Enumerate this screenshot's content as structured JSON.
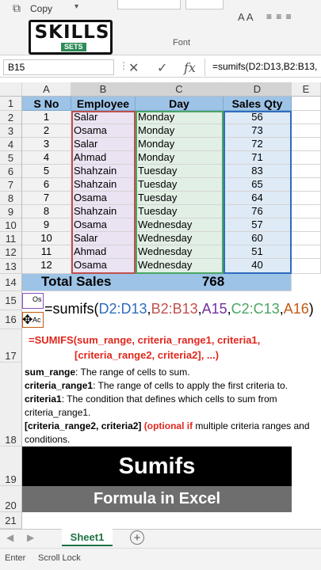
{
  "ribbon": {
    "copy_label": "Copy",
    "font_group_label": "Font"
  },
  "logo": {
    "top_text": "SKILLS",
    "bottom_text": "SETS"
  },
  "formula_bar": {
    "name_box": "B15",
    "formula": "=sumifs(D2:D13,B2:B13,"
  },
  "columns": [
    "A",
    "B",
    "C",
    "D",
    "E"
  ],
  "rows": [
    "1",
    "2",
    "3",
    "4",
    "5",
    "6",
    "7",
    "8",
    "9",
    "10",
    "11",
    "12",
    "13",
    "14",
    "15",
    "16",
    "17",
    "18",
    "19",
    "20",
    "21"
  ],
  "table": {
    "headers": [
      "S No",
      "Employee",
      "Day",
      "Sales Qty"
    ],
    "data": [
      [
        "1",
        "Salar",
        "Monday",
        "56"
      ],
      [
        "2",
        "Osama",
        "Monday",
        "73"
      ],
      [
        "3",
        "Salar",
        "Monday",
        "72"
      ],
      [
        "4",
        "Ahmad",
        "Monday",
        "71"
      ],
      [
        "5",
        "Shahzain",
        "Tuesday",
        "83"
      ],
      [
        "6",
        "Shahzain",
        "Tuesday",
        "65"
      ],
      [
        "7",
        "Osama",
        "Tuesday",
        "64"
      ],
      [
        "8",
        "Shahzain",
        "Tuesday",
        "76"
      ],
      [
        "9",
        "Osama",
        "Wednesday",
        "57"
      ],
      [
        "10",
        "Salar",
        "Wednesday",
        "60"
      ],
      [
        "11",
        "Ahmad",
        "Wednesday",
        "51"
      ],
      [
        "12",
        "Osama",
        "Wednesday",
        "40"
      ]
    ],
    "total_label": "Total Sales",
    "total_value": "768"
  },
  "cells": {
    "a15": "Os",
    "a16": "Ac"
  },
  "formula_parts": [
    "=sumifs(",
    "D2:D13",
    ",",
    "B2:B13",
    ",",
    "A15",
    ",",
    "C2:C13",
    ",",
    "A16",
    ")"
  ],
  "syntax_line1": "=SUMIFS(sum_range, criteria_range1, criteria1,",
  "syntax_line2": "[criteria_range2, criteria2], ...)",
  "descriptions": {
    "sum_range_term": "sum_range",
    "sum_range_text": ": The range of cells to sum.",
    "criteria_range1_term": "criteria_range1",
    "criteria_range1_text": ": The range of cells to apply the first criteria to.",
    "criteria1_term": "criteria1",
    "criteria1_text": ": The condition that defines which cells to sum from criteria_range1.",
    "optional_term": "[criteria_range2, criteria2]",
    "optional_note": "(optional if",
    "optional_text": " multiple criteria ranges and conditions."
  },
  "banner": {
    "title": "Sumifs",
    "subtitle": "Formula in Excel"
  },
  "sheet_tab": "Sheet1",
  "status": {
    "mode": "Enter",
    "scroll_lock": "Scroll Lock"
  },
  "colors": {
    "header_blue": "#9dc3e6",
    "ref_blue": "#2f6cbf",
    "ref_red": "#c0504d",
    "ref_purple": "#7030a0",
    "ref_green": "#4aa564",
    "ref_orange": "#c55a11",
    "syntax_red": "#e0281e",
    "excel_green": "#1e7145"
  }
}
